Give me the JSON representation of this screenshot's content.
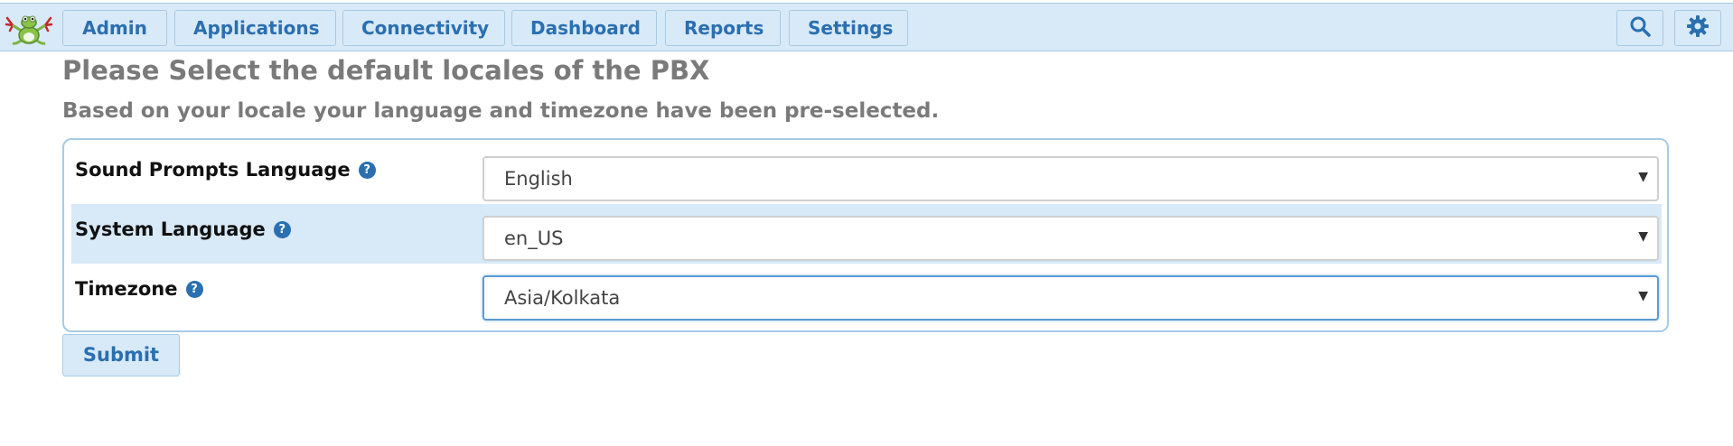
{
  "nav": {
    "items": [
      {
        "label": "Admin"
      },
      {
        "label": "Applications"
      },
      {
        "label": "Connectivity"
      },
      {
        "label": "Dashboard"
      },
      {
        "label": "Reports"
      },
      {
        "label": "Settings"
      }
    ],
    "icons": [
      "search-icon",
      "gear-icon"
    ]
  },
  "page": {
    "title": "Please Select the default locales of the PBX",
    "subtitle": "Based on your locale your language and timezone have been pre-selected."
  },
  "form": {
    "rows": [
      {
        "label": "Sound Prompts Language",
        "value": "English",
        "help_icon": "question-icon"
      },
      {
        "label": "System Language",
        "value": "en_US",
        "help_icon": "question-icon"
      },
      {
        "label": "Timezone",
        "value": "Asia/Kolkata",
        "help_icon": "question-icon"
      }
    ],
    "submit_label": "Submit"
  },
  "colors": {
    "nav_background": "#d8e9f7",
    "accent": "#2a6fb0",
    "border": "#a7cbe6",
    "heading": "#7a7a7a"
  }
}
